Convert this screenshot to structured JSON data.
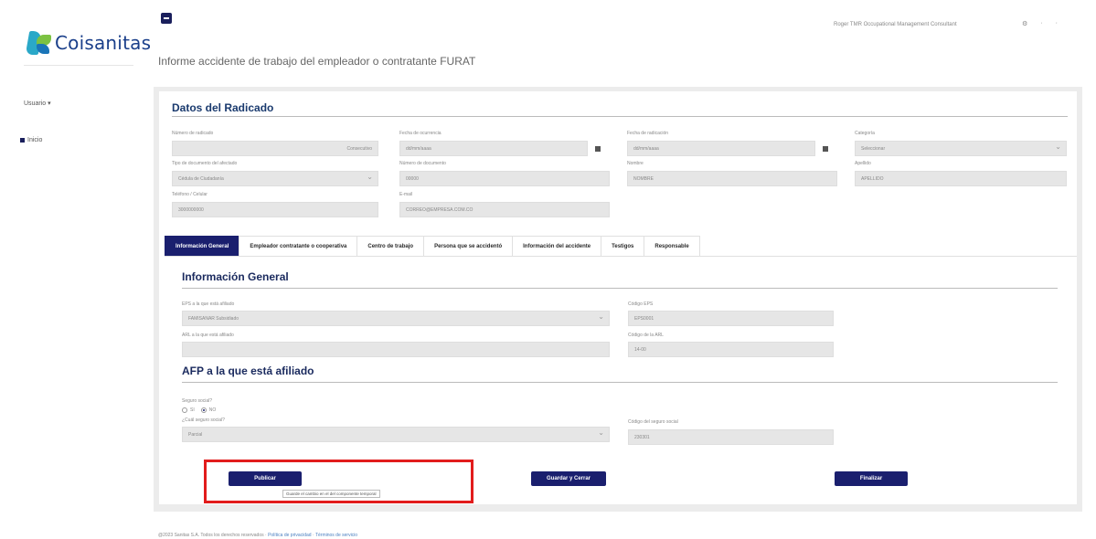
{
  "brand": {
    "name": "Coisanitas"
  },
  "sidebar": {
    "user_label": "Usuario ▾",
    "inicio_label": "Inicio"
  },
  "topbar": {
    "user_text": "Roger TMR Occupational Management Consultant",
    "icons": [
      "user-icon",
      "bell-icon",
      "logout-icon"
    ]
  },
  "page": {
    "title": "Informe accidente de trabajo del empleador o contratante FURAT"
  },
  "radicado": {
    "heading": "Datos del Radicado",
    "fields": {
      "numero_label": "Número de radicado",
      "numero_value": "Consecutivo",
      "fecha_ocurrencia_label": "Fecha de ocurrencia",
      "fecha_ocurrencia_value": "dd/mm/aaaa",
      "fecha_radicacion_label": "Fecha de radicación",
      "fecha_radicacion_value": "dd/mm/aaaa",
      "categoria_label": "Categoría",
      "categoria_value": "Seleccionar",
      "tipo_doc_label": "Tipo de documento del afectado",
      "tipo_doc_value": "Cédula de Ciudadanía",
      "num_doc_label": "Número de documento",
      "num_doc_value": "00000",
      "nombre_label": "Nombre",
      "nombre_value": "NOMBRE",
      "apellido_label": "Apellido",
      "apellido_value": "APELLIDO",
      "telefono_label": "Teléfono / Celular",
      "telefono_value": "3000000000",
      "email_label": "E-mail",
      "email_value": "CORREO@EMPRESA.COM.CO"
    }
  },
  "tabs": [
    {
      "label": "Información General",
      "active": true
    },
    {
      "label": "Empleador contratante o cooperativa",
      "active": false
    },
    {
      "label": "Centro de trabajo",
      "active": false
    },
    {
      "label": "Persona que se accidentó",
      "active": false
    },
    {
      "label": "Información del accidente",
      "active": false
    },
    {
      "label": "Testigos",
      "active": false
    },
    {
      "label": "Responsable",
      "active": false
    }
  ],
  "info_general": {
    "heading": "Información General",
    "eps_label": "EPS a la que está afiliado",
    "eps_value": "FAMISANAR Subsidiado",
    "codigo_eps_label": "Código EPS",
    "codigo_eps_value": "EPS0001",
    "arl_label": "ARL a la que está afiliado",
    "arl_value": "",
    "codigo_arl_label": "Código de la ARL",
    "codigo_arl_value": "14-00"
  },
  "afp": {
    "heading": "AFP a la que está afiliado",
    "seguro_label": "Seguro social?",
    "si_label": "SI",
    "no_label": "NO",
    "cual_label": "¿Cuál seguro social?",
    "cual_value": "Parcial",
    "codigo_label": "Código del seguro social",
    "codigo_value": "230301"
  },
  "actions": {
    "publicar_label": "Publicar",
    "guardar_label": "Guardar y Cerrar",
    "finalizar_label": "Finalizar",
    "tooltip": "Guarde el cambio en el del componente temporal"
  },
  "footer": {
    "copyright": "@2023 Sanitas S.A. Todos los derechos reservados",
    "link1": "Política de privacidad",
    "link2": "Términos de servicio"
  },
  "colors": {
    "primary": "#1a1f6e",
    "highlight": "#e21c1c",
    "heading": "#1a3a6e"
  }
}
